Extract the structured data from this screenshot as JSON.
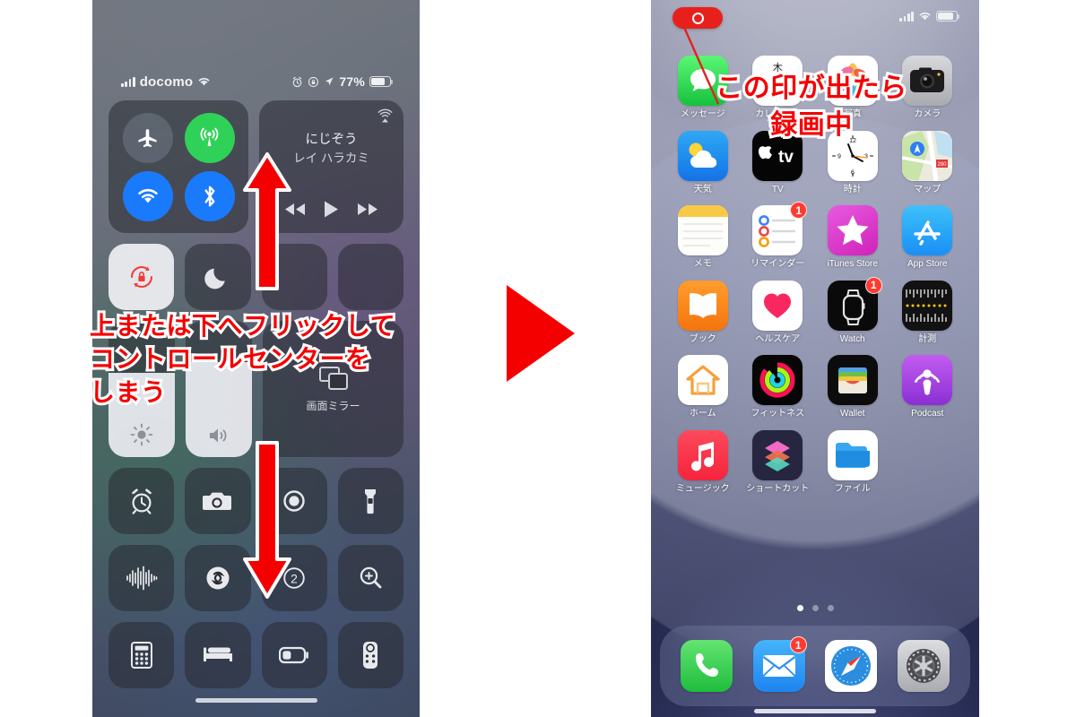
{
  "left_phone": {
    "status_bar": {
      "carrier": "docomo",
      "signal_icon": "cellular-signal-icon",
      "wifi_icon": "wifi-icon",
      "alarm_icon": "alarm-clock-icon",
      "rotation_lock_icon": "rotation-lock-icon",
      "location_icon": "location-arrow-icon",
      "battery_percent": "77%",
      "battery_icon": "battery-icon"
    },
    "control_center": {
      "connectivity": [
        {
          "name": "airplane-mode-toggle",
          "icon": "airplane-icon",
          "state": "off",
          "color": "#626a76"
        },
        {
          "name": "cellular-data-toggle",
          "icon": "cellular-tower-icon",
          "state": "on",
          "color": "#30d158"
        },
        {
          "name": "wifi-toggle",
          "icon": "wifi-icon",
          "state": "on",
          "color": "#1a7afc"
        },
        {
          "name": "bluetooth-toggle",
          "icon": "bluetooth-icon",
          "state": "on",
          "color": "#1a7afc"
        }
      ],
      "media": {
        "title": "にじぞう",
        "artist": "レイ ハラカミ",
        "airplay_icon": "airplay-icon",
        "rewind_icon": "rewind-icon",
        "play_icon": "play-icon",
        "forward_icon": "fast-forward-icon"
      },
      "tiles_row2": [
        {
          "name": "orientation-lock-tile",
          "icon": "rotation-lock-icon",
          "state": "on"
        },
        {
          "name": "do-not-disturb-tile",
          "icon": "moon-icon",
          "state": "off"
        },
        {
          "name": "screen-mirroring-tile",
          "icon": "screen-mirror-icon",
          "label": "画面ミラー"
        }
      ],
      "sliders": [
        {
          "name": "brightness-slider",
          "icon": "brightness-icon",
          "value_pct": 62
        },
        {
          "name": "volume-slider",
          "icon": "speaker-icon",
          "value_pct": 70
        }
      ],
      "shortcuts": [
        {
          "name": "alarm-shortcut",
          "icon": "alarm-clock-icon"
        },
        {
          "name": "camera-shortcut",
          "icon": "camera-icon"
        },
        {
          "name": "screen-record-shortcut",
          "icon": "screen-record-icon"
        },
        {
          "name": "flashlight-shortcut",
          "icon": "flashlight-icon"
        },
        {
          "name": "voice-memo-shortcut",
          "icon": "waveform-icon"
        },
        {
          "name": "shazam-shortcut",
          "icon": "shazam-icon"
        },
        {
          "name": "text-size-shortcut",
          "icon": "text-size-icon"
        },
        {
          "name": "magnifier-shortcut",
          "icon": "magnifier-icon"
        },
        {
          "name": "calculator-shortcut",
          "icon": "calculator-icon"
        },
        {
          "name": "sleep-shortcut",
          "icon": "bed-icon"
        },
        {
          "name": "low-power-shortcut",
          "icon": "battery-low-icon"
        },
        {
          "name": "remote-shortcut",
          "icon": "apple-tv-remote-icon"
        }
      ]
    }
  },
  "right_phone": {
    "recording_indicator": {
      "name": "screen-recording-indicator",
      "icon": "record-dot-icon",
      "color": "#e8201c"
    },
    "status_bar": {
      "signal_icon": "cellular-signal-icon",
      "wifi_icon": "wifi-icon",
      "battery_icon": "battery-icon"
    },
    "apps": [
      {
        "label": "メッセージ",
        "icon": "messages-icon",
        "badge": null
      },
      {
        "label": "カレンダー",
        "icon": "calendar-icon",
        "badge": null,
        "day_kanji": "木"
      },
      {
        "label": "写真",
        "icon": "photos-icon",
        "badge": null
      },
      {
        "label": "カメラ",
        "icon": "camera-app-icon",
        "badge": null
      },
      {
        "label": "天気",
        "icon": "weather-icon",
        "badge": null
      },
      {
        "label": "TV",
        "icon": "apple-tv-icon",
        "badge": null
      },
      {
        "label": "時計",
        "icon": "clock-icon",
        "badge": null
      },
      {
        "label": "マップ",
        "icon": "maps-icon",
        "badge": null
      },
      {
        "label": "メモ",
        "icon": "notes-icon",
        "badge": null
      },
      {
        "label": "リマインダー",
        "icon": "reminders-icon",
        "badge": "1"
      },
      {
        "label": "iTunes Store",
        "icon": "itunes-store-icon",
        "badge": null
      },
      {
        "label": "App Store",
        "icon": "app-store-icon",
        "badge": null
      },
      {
        "label": "ブック",
        "icon": "books-icon",
        "badge": null
      },
      {
        "label": "ヘルスケア",
        "icon": "health-icon",
        "badge": null
      },
      {
        "label": "Watch",
        "icon": "watch-icon",
        "badge": "1"
      },
      {
        "label": "計測",
        "icon": "measure-icon",
        "badge": null
      },
      {
        "label": "ホーム",
        "icon": "home-app-icon",
        "badge": null
      },
      {
        "label": "フィットネス",
        "icon": "fitness-icon",
        "badge": null
      },
      {
        "label": "Wallet",
        "icon": "wallet-icon",
        "badge": null
      },
      {
        "label": "Podcast",
        "icon": "podcasts-icon",
        "badge": null
      },
      {
        "label": "ミュージック",
        "icon": "music-icon",
        "badge": null
      },
      {
        "label": "ショートカット",
        "icon": "shortcuts-icon",
        "badge": null
      },
      {
        "label": "ファイル",
        "icon": "files-icon",
        "badge": null
      }
    ],
    "page_dots": {
      "count": 3,
      "active_index": 0
    },
    "dock": [
      {
        "label": "phone",
        "icon": "phone-icon",
        "badge": null
      },
      {
        "label": "mail",
        "icon": "mail-icon",
        "badge": "1"
      },
      {
        "label": "safari",
        "icon": "safari-icon",
        "badge": null
      },
      {
        "label": "settings",
        "icon": "settings-icon",
        "badge": null
      }
    ]
  },
  "annotations": {
    "accent_color": "#f50000",
    "outline_color": "#ffffff",
    "left_caption": {
      "lines": [
        "上または下へフリックして",
        "コントロールセンターを",
        "しまう"
      ]
    },
    "right_caption": {
      "lines": [
        "この印が出たら",
        "録画中"
      ]
    },
    "arrow_up": {
      "name": "flick-up-arrow",
      "direction": "up"
    },
    "arrow_down": {
      "name": "flick-down-arrow",
      "direction": "down"
    },
    "step_arrow": {
      "name": "step-progress-arrow",
      "direction": "right"
    },
    "callout_line": {
      "name": "recording-indicator-callout-line"
    }
  }
}
